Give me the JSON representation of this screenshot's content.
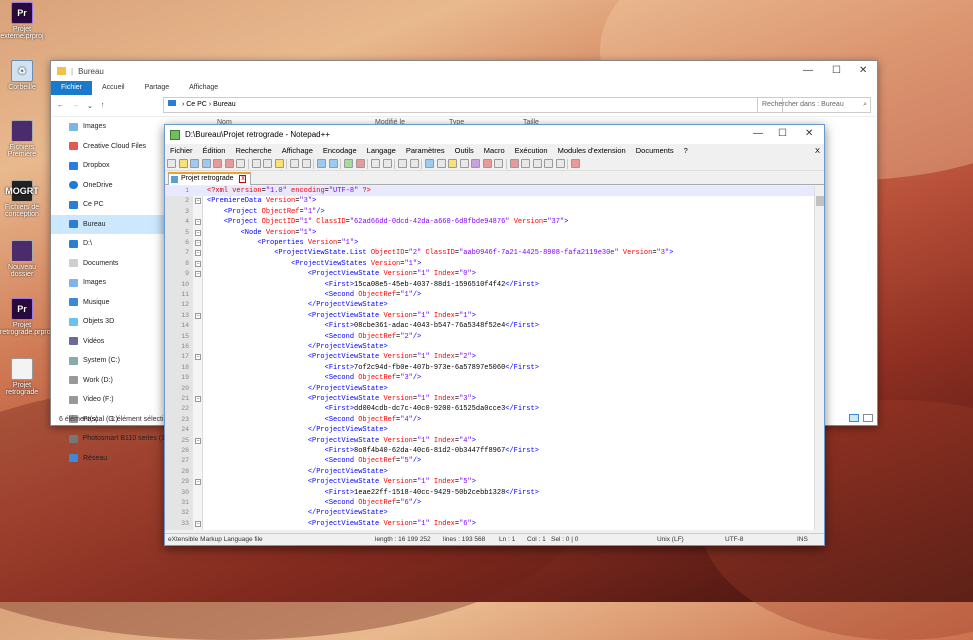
{
  "desktop": {
    "icons": [
      {
        "label": "Projet externe.prproj"
      },
      {
        "label": "Corbeille"
      },
      {
        "label": "Fichiers Première"
      },
      {
        "label": "Fichiers de conception"
      },
      {
        "label": "Nouveau dossier"
      },
      {
        "label": "Projet retrograde.prproj"
      },
      {
        "label": "Projet retrograde"
      }
    ]
  },
  "explorer": {
    "title": "Bureau",
    "ribbon": [
      "Fichier",
      "Accueil",
      "Partage",
      "Affichage"
    ],
    "breadcrumb": [
      "Ce PC",
      "Bureau"
    ],
    "search_placeholder": "Rechercher dans : Bureau",
    "columns": [
      "Nom",
      "Modifié le",
      "Type",
      "Taille"
    ],
    "nav": [
      {
        "label": "Images"
      },
      {
        "label": "Creative Cloud Files"
      },
      {
        "label": "Dropbox"
      },
      {
        "label": "OneDrive"
      },
      {
        "label": "Ce PC"
      },
      {
        "label": "Bureau"
      },
      {
        "label": "D:\\"
      },
      {
        "label": "Documents"
      },
      {
        "label": "Images"
      },
      {
        "label": "Musique"
      },
      {
        "label": "Objets 3D"
      },
      {
        "label": "Vidéos"
      },
      {
        "label": "System (C:)"
      },
      {
        "label": "Work (D:)"
      },
      {
        "label": "Video (F:)"
      },
      {
        "label": "Pascal (G:)"
      },
      {
        "label": "Photosmart B110 series (1"
      },
      {
        "label": "Réseau"
      }
    ],
    "status_count": "6 élément(s)",
    "status_selected": "1 élément sélecti"
  },
  "npp": {
    "title": "D:\\Bureau\\Projet retrograde - Notepad++",
    "menu": [
      "Fichier",
      "Édition",
      "Recherche",
      "Affichage",
      "Encodage",
      "Langage",
      "Paramètres",
      "Outils",
      "Macro",
      "Exécution",
      "Modules d'extension",
      "Documents",
      "?"
    ],
    "close_doc": "X",
    "tab": "Projet retrograde",
    "lines": [
      {
        "n": "1"
      },
      {
        "n": "2"
      },
      {
        "n": "3"
      },
      {
        "n": "4"
      },
      {
        "n": "5"
      },
      {
        "n": "6"
      },
      {
        "n": "7"
      },
      {
        "n": "8"
      },
      {
        "n": "9"
      },
      {
        "n": "10"
      },
      {
        "n": "11"
      },
      {
        "n": "12"
      },
      {
        "n": "13"
      },
      {
        "n": "14"
      },
      {
        "n": "15"
      },
      {
        "n": "16"
      },
      {
        "n": "17"
      },
      {
        "n": "18"
      },
      {
        "n": "19"
      },
      {
        "n": "20"
      },
      {
        "n": "21"
      },
      {
        "n": "22"
      },
      {
        "n": "23"
      },
      {
        "n": "24"
      },
      {
        "n": "25"
      },
      {
        "n": "26"
      },
      {
        "n": "27"
      },
      {
        "n": "28"
      },
      {
        "n": "29"
      },
      {
        "n": "30"
      },
      {
        "n": "31"
      },
      {
        "n": "32"
      },
      {
        "n": "33"
      }
    ],
    "code": [
      "<?xml version=\"1.0\" encoding=\"UTF-8\" ?>",
      "<PremiereData Version=\"3\">",
      "    <Project ObjectRef=\"1\"/>",
      "    <Project ObjectID=\"1\" ClassID=\"62ad66dd-0dcd-42da-a660-6d8fbde94876\" Version=\"37\">",
      "        <Node Version=\"1\">",
      "            <Properties Version=\"1\">",
      "                <ProjectViewState.List ObjectID=\"2\" ClassID=\"aab0946f-7a21-4425-8908-fafa2119e30e\" Version=\"3\">",
      "                    <ProjectViewStates Version=\"1\">",
      "                        <ProjectViewState Version=\"1\" Index=\"0\">",
      "                            <First>15ca08e5-45eb-4037-88d1-1596510f4f42</First>",
      "                            <Second ObjectRef=\"1\"/>",
      "                        </ProjectViewState>",
      "                        <ProjectViewState Version=\"1\" Index=\"1\">",
      "                            <First>08cbe361-adac-4043-b547-76a5348f52e4</First>",
      "                            <Second ObjectRef=\"2\"/>",
      "                        </ProjectViewState>",
      "                        <ProjectViewState Version=\"1\" Index=\"2\">",
      "                            <First>7of2c94d-fb0e-407b-973e-6a57897e5060</First>",
      "                            <Second ObjectRef=\"3\"/>",
      "                        </ProjectViewState>",
      "                        <ProjectViewState Version=\"1\" Index=\"3\">",
      "                            <First>dd004cdb-dc7c-40c0-9200-61525da0cce3</First>",
      "                            <Second ObjectRef=\"4\"/>",
      "                        </ProjectViewState>",
      "                        <ProjectViewState Version=\"1\" Index=\"4\">",
      "                            <First>8o8f4b40-62da-40c6-81d2-0b3447ff8967</First>",
      "                            <Second ObjectRef=\"5\"/>",
      "                        </ProjectViewState>",
      "                        <ProjectViewState Version=\"1\" Index=\"5\">",
      "                            <First>1eae22ff-1518-40cc-9429-50b2cebb1328</First>",
      "                            <Second ObjectRef=\"6\"/>",
      "                        </ProjectViewState>",
      "                        <ProjectViewState Version=\"1\" Index=\"6\">"
    ],
    "status": {
      "lang": "eXtensible Markup Language file",
      "length": "length : 16 199 252",
      "lines": "lines : 193 568",
      "ln": "Ln : 1",
      "col": "Col : 1",
      "sel": "Sel : 0 | 0",
      "eol": "Unix (LF)",
      "enc": "UTF-8",
      "mode": "INS"
    }
  }
}
